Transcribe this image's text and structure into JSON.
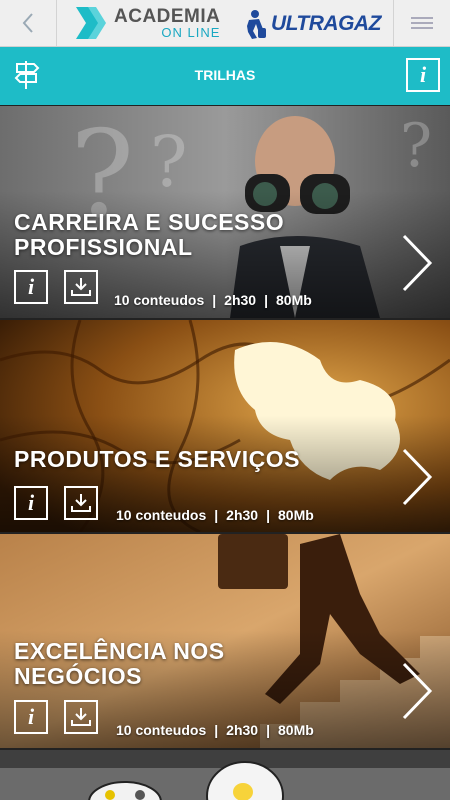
{
  "header": {
    "back_icon": "chevron-left-icon",
    "brand_title": "ACADEMIA",
    "brand_subtitle": "ON LINE",
    "partner_name": "ULTRAGAZ",
    "menu_icon": "hamburger-icon"
  },
  "navbar": {
    "title": "TRILHAS",
    "signpost_icon": "signpost-icon",
    "info_label": "i"
  },
  "trails": [
    {
      "title_line1": "CARREIRA E SUCESSO",
      "title_line2": "PROFISSIONAL",
      "contents": "10 conteudos",
      "duration": "2h30",
      "size": "80Mb",
      "info_label": "i",
      "separator": "|"
    },
    {
      "title_line1": "PRODUTOS E SERVIÇOS",
      "title_line2": "",
      "contents": "10 conteudos",
      "duration": "2h30",
      "size": "80Mb",
      "info_label": "i",
      "separator": "|"
    },
    {
      "title_line1": "EXCELÊNCIA NOS",
      "title_line2": "NEGÓCIOS",
      "contents": "10 conteudos",
      "duration": "2h30",
      "size": "80Mb",
      "info_label": "i",
      "separator": "|"
    }
  ],
  "colors": {
    "accent": "#1ebcc7",
    "brand_blue": "#1f4a9c",
    "header_bg": "#efefef"
  }
}
